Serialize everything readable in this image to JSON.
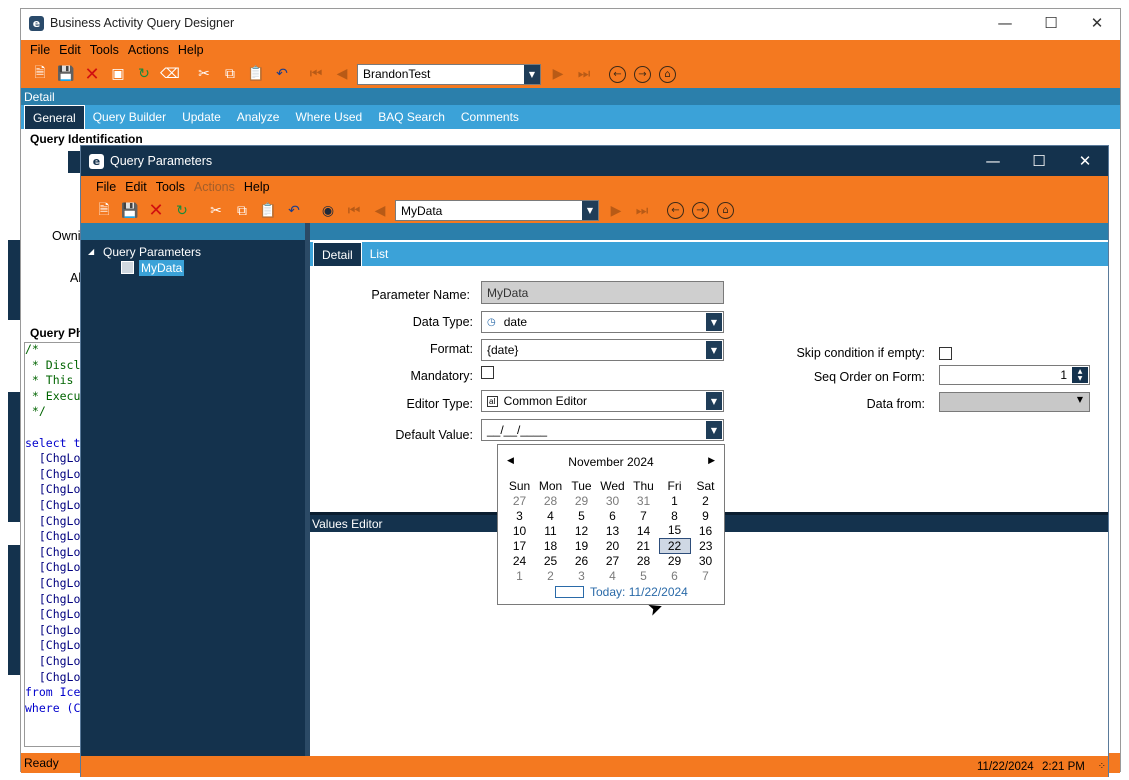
{
  "main_window": {
    "title": "Business Activity Query Designer",
    "menu": [
      "File",
      "Edit",
      "Tools",
      "Actions",
      "Help"
    ],
    "nav_value": "BrandonTest",
    "detail_bar": "Detail",
    "tabs": [
      "General",
      "Query Builder",
      "Update",
      "Analyze",
      "Where Used",
      "BAQ Search",
      "Comments"
    ],
    "section_identification": "Query Identification",
    "owner_label": "Owni",
    "all_label": "Al",
    "section_phrase": "Query Phr",
    "sql_lines": [
      "/*",
      " * Discl",
      " * This",
      " * Execu",
      " */",
      "",
      "select t",
      "  [ChgLo",
      "  [ChgLo",
      "  [ChgLo",
      "  [ChgLo",
      "  [ChgLo",
      "  [ChgLo",
      "  [ChgLo",
      "  [ChgLo",
      "  [ChgLo",
      "  [ChgLo",
      "  [ChgLo",
      "  [ChgLo",
      "  [ChgLo",
      "  [ChgLo",
      "  [ChgLo",
      "from Ice",
      "where (C"
    ],
    "status": "Ready"
  },
  "dialog": {
    "title": "Query Parameters",
    "menu": [
      "File",
      "Edit",
      "Tools",
      "Actions",
      "Help"
    ],
    "nav_value": "MyData",
    "tree_root": "Query Parameters",
    "tree_child": "MyData",
    "tabs": [
      "Detail",
      "List"
    ],
    "form": {
      "parameter_name_label": "Parameter Name:",
      "parameter_name_value": "MyData",
      "data_type_label": "Data Type:",
      "data_type_value": "date",
      "format_label": "Format:",
      "format_value": "{date}",
      "mandatory_label": "Mandatory:",
      "editor_type_label": "Editor Type:",
      "editor_type_value": "Common Editor",
      "default_value_label": "Default Value:",
      "default_value_value": "__/__/____",
      "skip_label": "Skip condition if empty:",
      "seq_label": "Seq Order on Form:",
      "seq_value": "1",
      "data_from_label": "Data from:"
    },
    "values_editor": "Values Editor",
    "status_date": "11/22/2024",
    "status_time": "2:21 PM"
  },
  "calendar": {
    "month_year": "November 2024",
    "days_of_week": [
      "Sun",
      "Mon",
      "Tue",
      "Wed",
      "Thu",
      "Fri",
      "Sat"
    ],
    "weeks": [
      [
        "27",
        "28",
        "29",
        "30",
        "31",
        "1",
        "2"
      ],
      [
        "3",
        "4",
        "5",
        "6",
        "7",
        "8",
        "9"
      ],
      [
        "10",
        "11",
        "12",
        "13",
        "14",
        "15",
        "16"
      ],
      [
        "17",
        "18",
        "19",
        "20",
        "21",
        "22",
        "23"
      ],
      [
        "24",
        "25",
        "26",
        "27",
        "28",
        "29",
        "30"
      ],
      [
        "1",
        "2",
        "3",
        "4",
        "5",
        "6",
        "7"
      ]
    ],
    "selected": "22",
    "today_text": "Today: 11/22/2024"
  },
  "colors": {
    "accent_orange": "#f47920",
    "navy": "#14324d",
    "tab_blue": "#3ba2d8"
  }
}
